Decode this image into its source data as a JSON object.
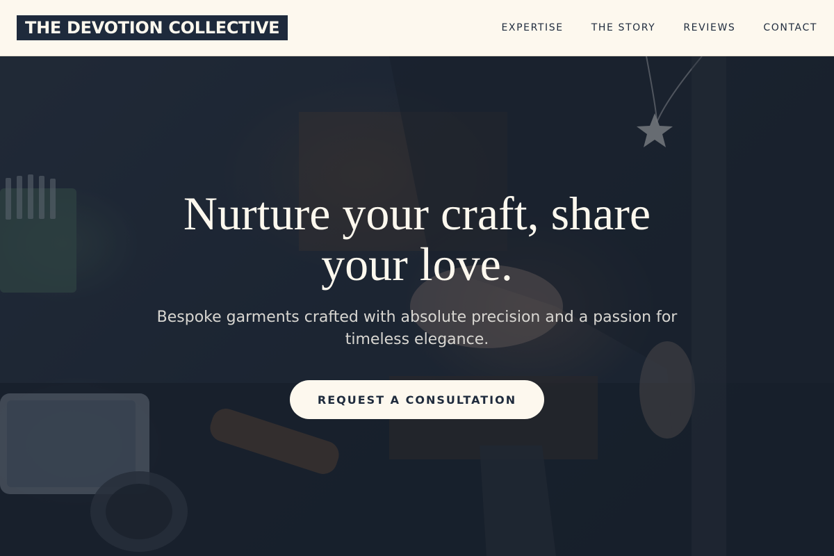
{
  "brand": {
    "name": "THE DEVOTION COLLECTIVE"
  },
  "nav": {
    "items": [
      {
        "label": "EXPERTISE"
      },
      {
        "label": "THE STORY"
      },
      {
        "label": "REVIEWS"
      },
      {
        "label": "CONTACT"
      }
    ]
  },
  "hero": {
    "headline": "Nurture your craft, share your love.",
    "subheadline": "Bespoke garments crafted with absolute precision and a passion for timeless elegance.",
    "cta_label": "REQUEST A CONSULTATION"
  },
  "colors": {
    "header_bg": "#fdf8ee",
    "brand_bg": "#1e2a3c",
    "text_dark": "#1e2a3c",
    "hero_overlay": "#18202e"
  }
}
